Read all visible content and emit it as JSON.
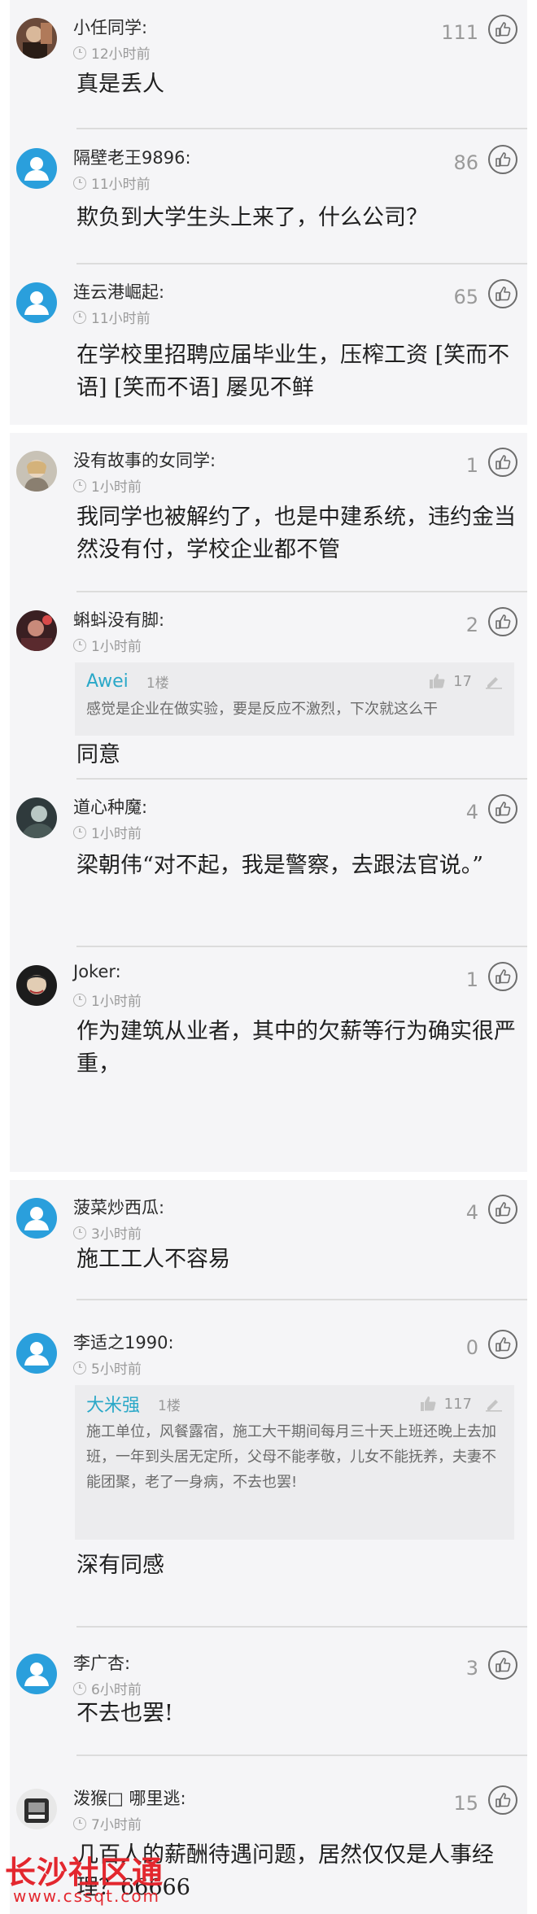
{
  "comments": [
    {
      "user": "小任同学:",
      "time": "12小时前",
      "likes": "111",
      "avatar": "photo",
      "text": "真是丢人"
    },
    {
      "user": "隔壁老王9896:",
      "time": "11小时前",
      "likes": "86",
      "avatar": "default",
      "text": "欺负到大学生头上来了，什么公司？"
    },
    {
      "user": "连云港崛起:",
      "time": "11小时前",
      "likes": "65",
      "avatar": "default",
      "text": "在学校里招聘应届毕业生，压榨工资 [笑而不语] [笑而不语] 屡见不鲜"
    },
    {
      "user": "没有故事的女同学:",
      "time": "1小时前",
      "likes": "1",
      "avatar": "photo",
      "text": "我同学也被解约了，也是中建系统，违约金当然没有付，学校企业都不管"
    },
    {
      "user": "蝌蚪没有脚:",
      "time": "1小时前",
      "likes": "2",
      "avatar": "photo",
      "text": "同意",
      "quote": {
        "name": "Awei",
        "floor": "1楼",
        "likes": "17",
        "text": "感觉是企业在做实验，要是反应不激烈，下次就这么干"
      }
    },
    {
      "user": "道心种魔:",
      "time": "1小时前",
      "likes": "4",
      "avatar": "photo",
      "text": "梁朝伟“对不起，我是警察，去跟法官说。”"
    },
    {
      "user": "Joker:",
      "time": "1小时前",
      "likes": "1",
      "avatar": "photo",
      "text": "作为建筑从业者，其中的欠薪等行为确实很严重，"
    },
    {
      "user": "菠菜炒西瓜:",
      "time": "3小时前",
      "likes": "4",
      "avatar": "default",
      "text": "施工工人不容易"
    },
    {
      "user": "李适之1990:",
      "time": "5小时前",
      "likes": "0",
      "avatar": "default",
      "text": "深有同感",
      "quote": {
        "name": "大米强",
        "floor": "1楼",
        "likes": "117",
        "text": "施工单位，风餐露宿，施工大干期间每月三十天上班还晚上去加班，一年到头居无定所，父母不能孝敬，儿女不能抚养，夫妻不能团聚，老了一身病，不去也罢!"
      }
    },
    {
      "user": "李广杏:",
      "time": "6小时前",
      "likes": "3",
      "avatar": "default",
      "text": "不去也罢!"
    },
    {
      "user": "泼猴□ 哪里逃:",
      "time": "7小时前",
      "likes": "15",
      "avatar": "photo",
      "text": "几百人的薪酬待遇问题，居然仅仅是人事经理？66666"
    }
  ],
  "watermark": {
    "title": "长沙社区通",
    "url": "www.cssqt.com"
  },
  "colors": {
    "accent_blue": "#2a9fdc",
    "quote_name": "#2aa8c8",
    "watermark_red": "#e3272e"
  }
}
